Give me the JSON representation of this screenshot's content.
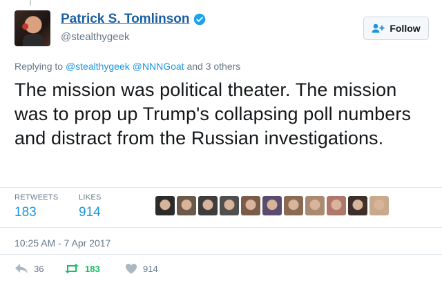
{
  "author": {
    "name": "Patrick S. Tomlinson",
    "handle": "@stealthygeek",
    "verified": true
  },
  "follow_button": {
    "label": "Follow",
    "icon": "add-user-icon"
  },
  "replying": {
    "prefix": "Replying to",
    "mention1": "@stealthygeek",
    "mention2": "@NNNGoat",
    "suffix": "and 3 others"
  },
  "tweet": {
    "text": "The mission was political theater. The mission was to prop up Trump's collapsing poll numbers and distract from the Russian investigations."
  },
  "stats": {
    "retweets_label": "RETWEETS",
    "retweets_value": "183",
    "likes_label": "LIKES",
    "likes_value": "914"
  },
  "liker_avatars": [
    "#2b2b2b",
    "#6b5a4a",
    "#3d3d3d",
    "#4f4f4f",
    "#7a5c48",
    "#5b4b6e",
    "#8a6a52",
    "#a98a72",
    "#b0786a",
    "#3e2f2a",
    "#c9a98c"
  ],
  "timestamp": "10:25 AM - 7 Apr 2017",
  "actions": {
    "reply_count": "36",
    "retweet_count": "183",
    "like_count": "914"
  },
  "colors": {
    "link": "#1b95e0",
    "retweet": "#17bf63",
    "muted": "#657786",
    "verified": "#1da1f2"
  }
}
